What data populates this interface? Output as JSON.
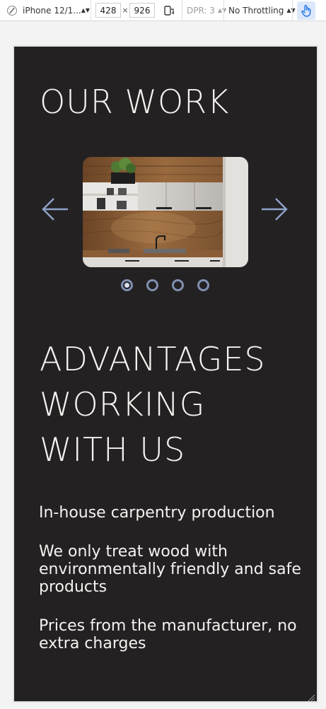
{
  "toolbar": {
    "device": "iPhone 12/1...",
    "width": "428",
    "times": "×",
    "height": "926",
    "dpr": "DPR: 3",
    "throttling": "No Throttling"
  },
  "page": {
    "work_title": "OUR WORK",
    "advantages_title_line1": "ADVANTAGES",
    "advantages_title_line2": "WORKING",
    "advantages_title_line3": "WITH US",
    "advantages": [
      "In-house carpentry production",
      "We only treat wood with environmentally friendly and safe products",
      "Prices from the manufacturer, no extra charges"
    ],
    "carousel": {
      "active_index": 0,
      "count": 4
    }
  },
  "colors": {
    "background": "#232122",
    "text": "#f5f3ef",
    "arrow": "#8fa3c8",
    "dot": "#8090b0"
  }
}
